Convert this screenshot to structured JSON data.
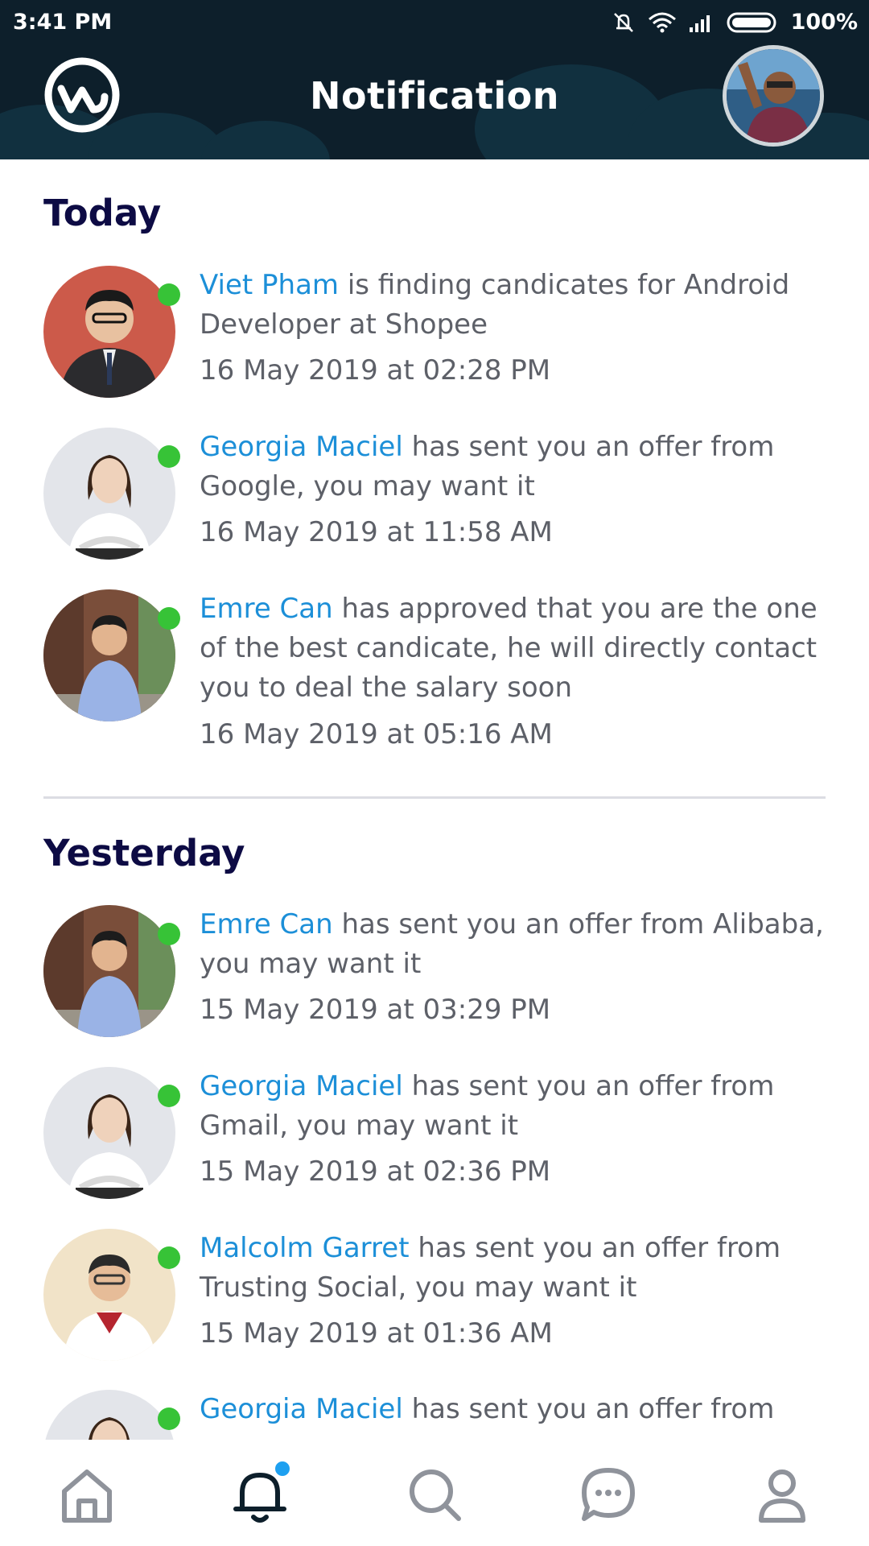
{
  "status_bar": {
    "time": "3:41 PM",
    "battery": "100%",
    "icons": [
      "silent-icon",
      "wifi-icon",
      "signal-icon",
      "battery-icon"
    ]
  },
  "header": {
    "title": "Notification",
    "logo_icon": "workplace-logo-icon",
    "avatar_alt": "profile-avatar"
  },
  "sections": {
    "today": {
      "title": "Today",
      "items": [
        {
          "name": "Viet Pham",
          "message": "is finding candicates for Android Developer at Shopee",
          "time": "16 May 2019 at 02:28 PM"
        },
        {
          "name": "Georgia Maciel",
          "message": "has sent you an offer from Google, you may want it",
          "time": "16 May 2019 at 11:58 AM"
        },
        {
          "name": "Emre Can",
          "message": "has approved that you are the one of the best candicate, he will directly contact you to deal the salary soon",
          "time": "16 May 2019 at 05:16 AM"
        }
      ]
    },
    "yesterday": {
      "title": "Yesterday",
      "items": [
        {
          "name": "Emre Can",
          "message": "has sent you an offer from Alibaba, you may want it",
          "time": "15 May 2019 at 03:29 PM"
        },
        {
          "name": "Georgia Maciel",
          "message": "has sent you an offer from Gmail, you may want it",
          "time": "15 May 2019 at 02:36 PM"
        },
        {
          "name": "Malcolm Garret",
          "message": "has sent you an offer from Trusting Social, you may want it",
          "time": "15 May 2019 at 01:36 AM"
        },
        {
          "name": "Georgia Maciel",
          "message": "has sent you an offer from",
          "time": ""
        }
      ]
    }
  },
  "bottom_nav": {
    "items": [
      "home-icon",
      "bell-icon",
      "search-icon",
      "chat-icon",
      "profile-icon"
    ],
    "active": "bell-icon"
  },
  "colors": {
    "header_bg": "#0d1f2b",
    "name_link": "#1c8fd8",
    "body_text": "#5d6068",
    "section_title": "#0d0b44",
    "online": "#37c337",
    "badge": "#1ea0f0"
  }
}
